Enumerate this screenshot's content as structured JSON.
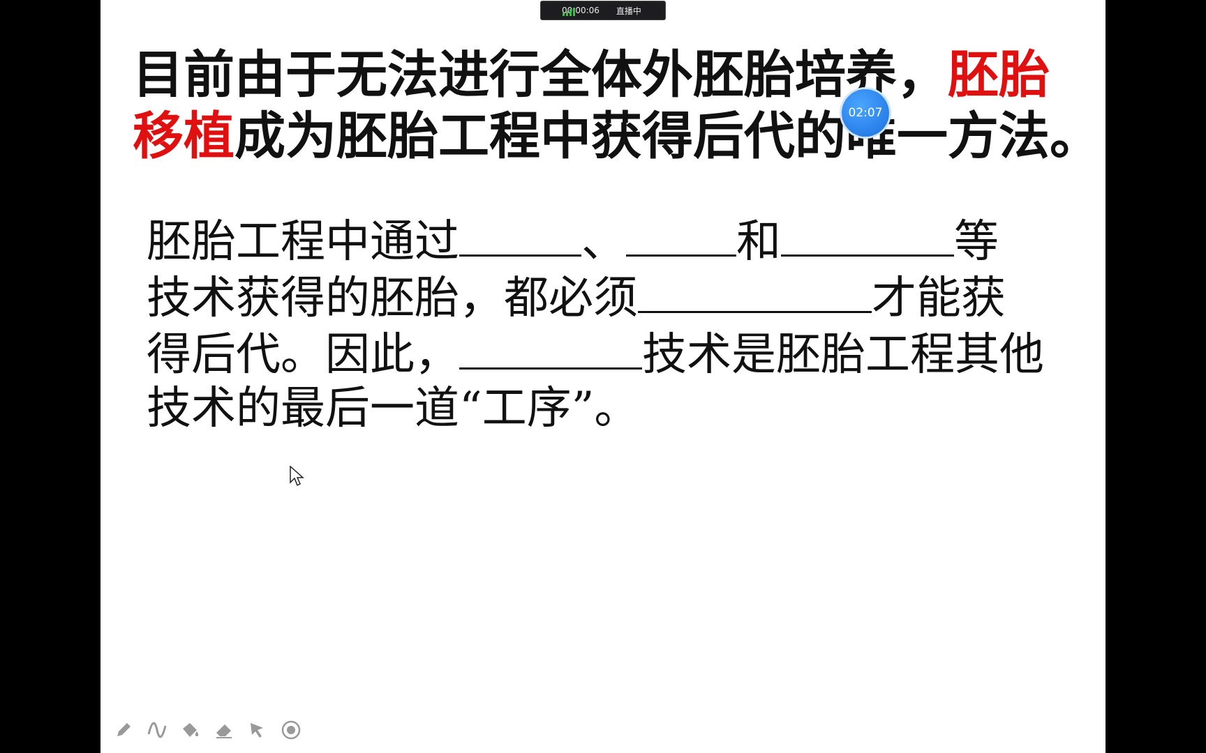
{
  "status": {
    "elapsed": "00:00:06",
    "state": "直播中"
  },
  "timer": {
    "label": "02:07"
  },
  "title": {
    "part1": "目前由于无法进行全体外胚胎培养，",
    "highlight1": "胚胎",
    "highlight2": "移植",
    "part2": "成为胚胎工程中获得后代的唯一方法。"
  },
  "question": {
    "l1a": "胚胎工程中通过",
    "l1b": "、",
    "l1c": "和",
    "l1d": "等",
    "l2a": "技术获得的胚胎，都必须",
    "l2b": "才能获",
    "l3a": "得后代。因此，",
    "l3b": "技术是胚胎工程其他",
    "l4": "技术的最后一道“工序”。"
  },
  "toolbar": {
    "icons": [
      "pencil-icon",
      "curve-icon",
      "fill-icon",
      "eraser-icon",
      "pointer-icon",
      "record-icon"
    ]
  },
  "colors": {
    "highlight": "#e01010",
    "signal": "#3bbf4a",
    "timer": "#1a6fe0"
  }
}
